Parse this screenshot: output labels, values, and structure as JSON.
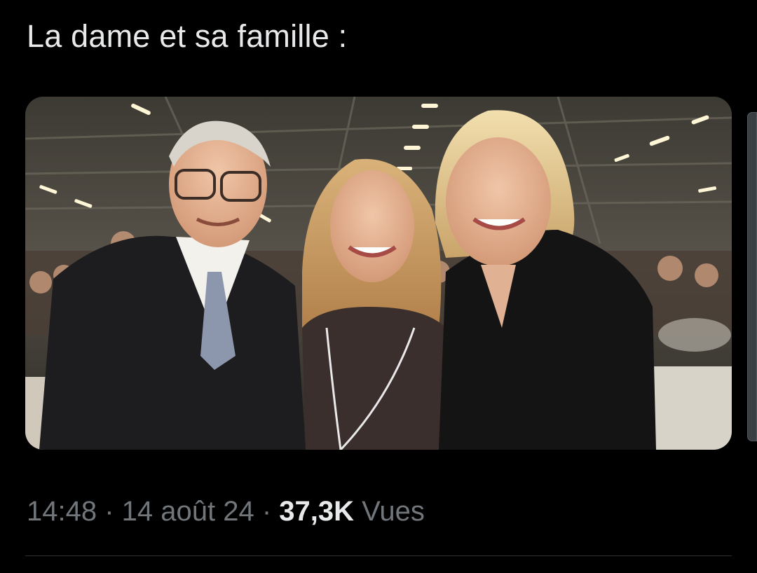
{
  "tweet": {
    "text": "La dame et sa famille :"
  },
  "media": {
    "type": "photo",
    "subjects": [
      "elderly-man-glasses",
      "young-woman-long-blonde-hair",
      "blonde-woman-black-jacket"
    ]
  },
  "meta": {
    "time": "14:48",
    "sep1": " · ",
    "date": "14 août 24",
    "sep2": " · ",
    "views_count": "37,3K",
    "views_label": " Vues"
  },
  "colors": {
    "background": "#000000",
    "primary_text": "#e7e9ea",
    "secondary_text": "#71767b",
    "divider": "#2f3336"
  }
}
